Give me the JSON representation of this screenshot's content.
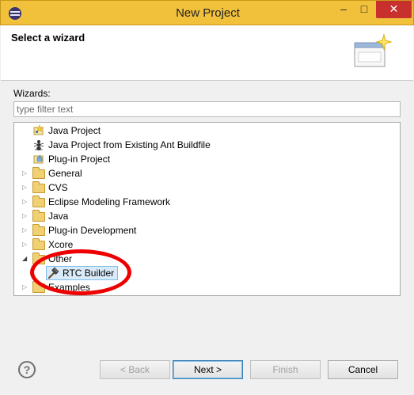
{
  "window": {
    "title": "New Project",
    "minimize_label": "–",
    "maximize_label": "□",
    "close_label": "✕"
  },
  "header": {
    "title": "Select a wizard"
  },
  "wizards": {
    "label": "Wizards:",
    "filter_placeholder": "type filter text"
  },
  "tree": {
    "items": [
      {
        "label": "Java Project",
        "icon": "java-project-icon"
      },
      {
        "label": "Java Project from Existing Ant Buildfile",
        "icon": "ant-icon"
      },
      {
        "label": "Plug-in Project",
        "icon": "plugin-project-icon"
      },
      {
        "label": "General",
        "icon": "folder-icon"
      },
      {
        "label": "CVS",
        "icon": "folder-icon"
      },
      {
        "label": "Eclipse Modeling Framework",
        "icon": "folder-icon"
      },
      {
        "label": "Java",
        "icon": "folder-icon"
      },
      {
        "label": "Plug-in Development",
        "icon": "folder-icon"
      },
      {
        "label": "Xcore",
        "icon": "folder-icon"
      },
      {
        "label": "Other",
        "icon": "folder-icon",
        "expanded": true
      },
      {
        "label": "RTC Builder",
        "icon": "hammer-icon",
        "selected": true
      },
      {
        "label": "Examples",
        "icon": "folder-icon"
      }
    ]
  },
  "buttons": {
    "help": "?",
    "back": "< Back",
    "next": "Next >",
    "finish": "Finish",
    "cancel": "Cancel"
  },
  "colors": {
    "titlebar": "#f2c13c",
    "close_button": "#c7302c",
    "annotation": "#ee0000",
    "selection": "#d9ebf9"
  }
}
